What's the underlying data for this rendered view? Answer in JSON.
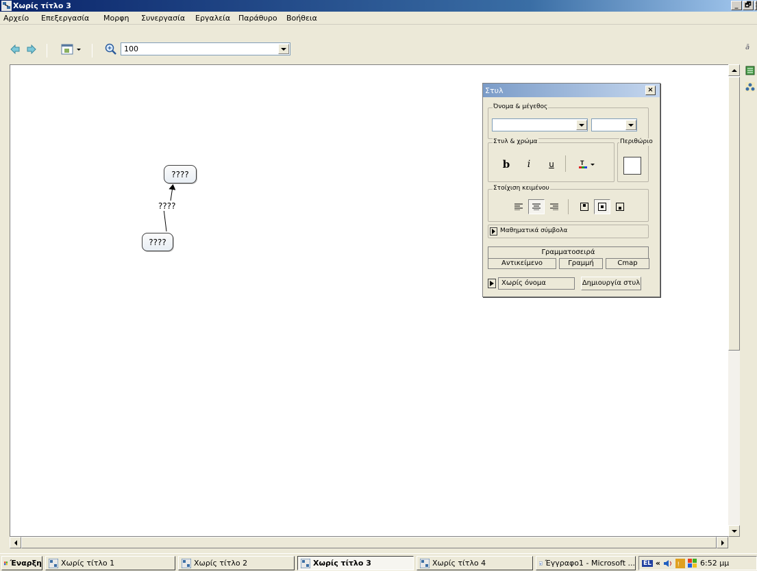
{
  "window": {
    "title": "Χωρίς τίτλο 3",
    "controls": [
      "_",
      "🗗",
      "×"
    ]
  },
  "menu": [
    "Αρχείο",
    "Επεξεργασία",
    "Μορφη",
    "Συνεργασία",
    "Εργαλεία",
    "Παράθυρο",
    "Βοήθεια"
  ],
  "toolbar": {
    "zoom_value": "100"
  },
  "concept_map": {
    "top_concept": "????",
    "bottom_concept": "????",
    "link_label": "????"
  },
  "styles_panel": {
    "title": "Στυλ",
    "close": "×",
    "name_size_label": "Όνομα & μέγεθος",
    "style_color_label": "Στυλ & χρώμα",
    "border_label": "Περιθώριο",
    "bold": "b",
    "italic": "i",
    "underline": "u",
    "alignment_label": "Στοίχιση κειμένου",
    "math_symbols": "Μαθηματικά σύμβολα",
    "tabs": {
      "font": "Γραμματοσειρά",
      "object": "Αντικείμενο",
      "line": "Γραμμή",
      "cmap": "Cmap"
    },
    "style_name": "Χωρίς όνομα",
    "create_style": "Δημιουργία στυλ"
  },
  "taskbar": {
    "start": "Έναρξη",
    "tasks": [
      "Χωρίς τίτλο 1",
      "Χωρίς τίτλο 2",
      "Χωρίς τίτλο 3",
      "Χωρίς τίτλο 4",
      "Έγγραφο1 - Microsoft ..."
    ],
    "language": "EL",
    "time": "6:52 μμ"
  },
  "colors": {
    "title_bar": "#0a246a",
    "chrome": "#ece9d8",
    "panel_title": "#7b9cc8"
  }
}
